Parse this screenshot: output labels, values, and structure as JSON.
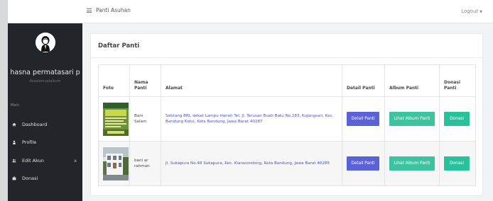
{
  "header": {
    "app_title": "Panti Asuhan",
    "logout_label": "Logout"
  },
  "sidebar": {
    "user_name": "hasna permatasari p",
    "greeting": "Assalamualaikum",
    "section_label": "Main",
    "items": [
      {
        "label": "Dashboard",
        "icon": "home-icon"
      },
      {
        "label": "Profile",
        "icon": "user-icon"
      },
      {
        "label": "Edit Akun",
        "icon": "users-icon"
      },
      {
        "label": "Donasi",
        "icon": "briefcase-icon"
      }
    ]
  },
  "card": {
    "title": "Daftar Panti",
    "columns": {
      "foto": "Foto",
      "nama": "Nama Panti",
      "alamat": "Alamat",
      "detail": "Detail Panti",
      "album": "Album Panti",
      "donasi": "Donasi Panti"
    },
    "rows": [
      {
        "nama": "Bani Salam",
        "alamat": "Sebrang BRI, dekat Lampu merah Tel. Jl. Terusan Buah Batu No.283, Kujangsari, Kec. Bandung Kidul, Kota Bandung, Jawa Barat 40287",
        "detail_label": "Detail Panti",
        "album_label": "Lihat Album Panti",
        "donasi_label": "Donasi"
      },
      {
        "nama": "bani ar rahman",
        "alamat": "Jl. Sukapura No.48 Sukapura, Kec. Kiaracondong, Kota Bandung, Jawa Barat 40285",
        "detail_label": "Detail Panti",
        "album_label": "Lihat Album Panti",
        "donasi_label": "Donasi"
      }
    ]
  },
  "colors": {
    "sidebar_bg": "#22262a",
    "detail_button": "#5a62d8",
    "album_button": "#3cc4a0",
    "donasi_button": "#27c29a",
    "address_link": "#4a52c2"
  }
}
